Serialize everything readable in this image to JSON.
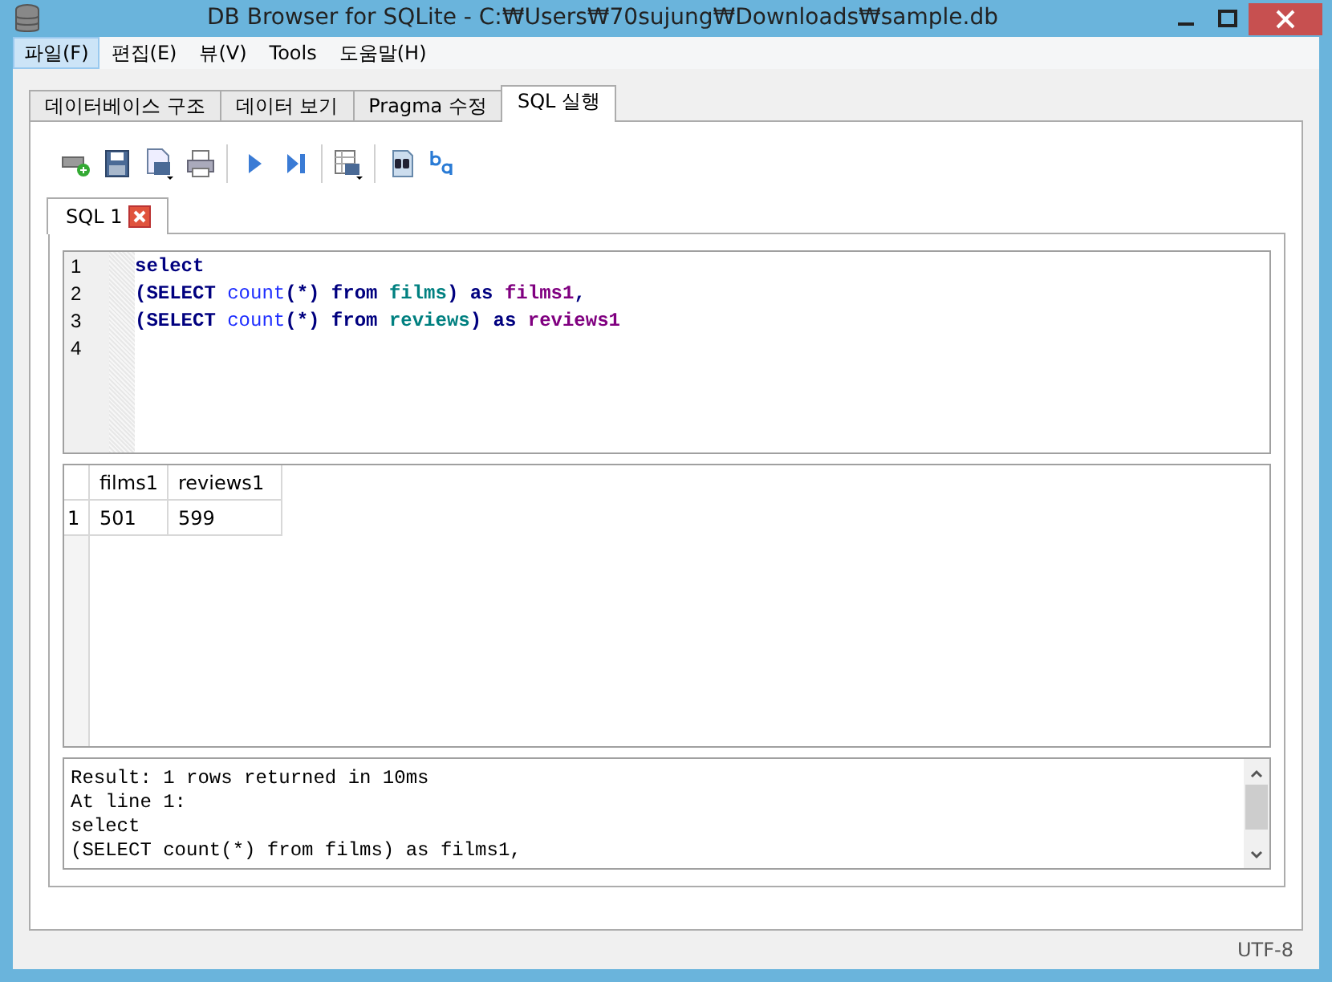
{
  "window": {
    "title": "DB Browser for SQLite - C:₩Users₩70sujung₩Downloads₩sample.db"
  },
  "menu": [
    {
      "label": "파일(F)",
      "selected": true
    },
    {
      "label": "편집(E)",
      "selected": false
    },
    {
      "label": "뷰(V)",
      "selected": false
    },
    {
      "label": "Tools",
      "selected": false
    },
    {
      "label": "도움말(H)",
      "selected": false
    }
  ],
  "tabs": [
    {
      "label": "데이터베이스 구조",
      "selected": false
    },
    {
      "label": "데이터 보기",
      "selected": false
    },
    {
      "label": "Pragma 수정",
      "selected": false
    },
    {
      "label": "SQL 실행",
      "selected": true
    }
  ],
  "editor_tabs": [
    {
      "label": "SQL 1",
      "selected": true
    }
  ],
  "editor": {
    "lines": [
      {
        "number": "1",
        "tokens": [
          {
            "text": "select",
            "kind": "keyword"
          }
        ]
      },
      {
        "number": "2",
        "tokens": [
          {
            "text": "(SELECT ",
            "kind": "keyword"
          },
          {
            "text": "count",
            "kind": "function"
          },
          {
            "text": "(*) from ",
            "kind": "keyword"
          },
          {
            "text": "films",
            "kind": "table"
          },
          {
            "text": ") as ",
            "kind": "keyword"
          },
          {
            "text": "films1",
            "kind": "alias"
          },
          {
            "text": ",",
            "kind": "keyword"
          }
        ]
      },
      {
        "number": "3",
        "tokens": [
          {
            "text": "(SELECT ",
            "kind": "keyword"
          },
          {
            "text": "count",
            "kind": "function"
          },
          {
            "text": "(*) from ",
            "kind": "keyword"
          },
          {
            "text": "reviews",
            "kind": "table"
          },
          {
            "text": ") as ",
            "kind": "keyword"
          },
          {
            "text": "reviews1",
            "kind": "alias"
          }
        ]
      },
      {
        "number": "4"
      }
    ]
  },
  "results": {
    "columns": [
      "films1",
      "reviews1"
    ],
    "rows": [
      {
        "number": "1",
        "cells": [
          "501",
          "599"
        ]
      }
    ]
  },
  "log": [
    "Result: 1 rows returned in 10ms",
    "At line 1:",
    "select",
    "(SELECT count(*) from films) as films1,"
  ],
  "status_bar": {
    "encoding": "UTF-8"
  }
}
